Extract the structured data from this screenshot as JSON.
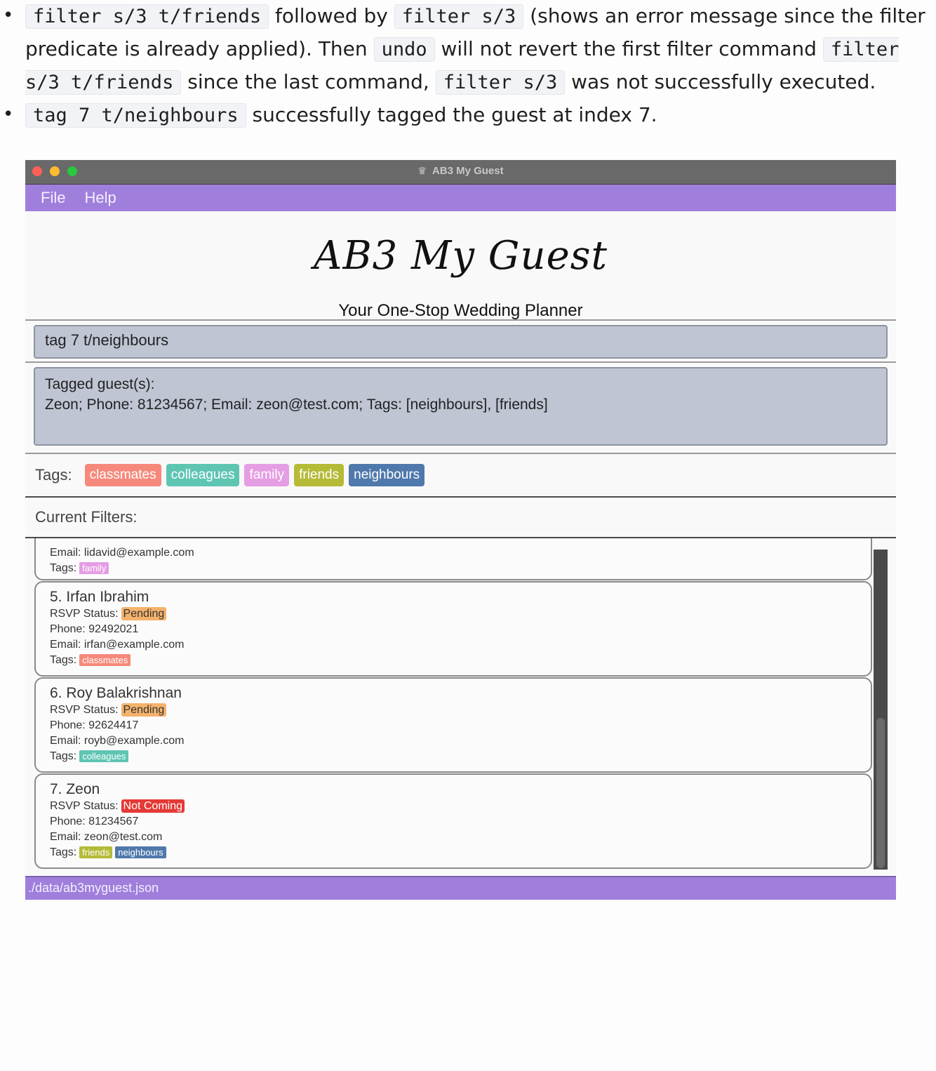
{
  "doc": {
    "bullet1": {
      "code1": "filter s/3 t/friends",
      "text1": " followed by ",
      "code2": "filter s/3",
      "text2": " (shows an error message since the filter predicate is already applied). Then ",
      "code3": "undo",
      "text3": " will not revert the first filter command ",
      "code4": "filter s/3 t/friends",
      "text4": " since the last command, ",
      "code5": "filter s/3",
      "text5": " was not successfully executed."
    },
    "bullet2": {
      "code1": "tag 7 t/neighbours",
      "text1": " successfully tagged the guest at index 7."
    }
  },
  "window": {
    "title": "AB3 My Guest",
    "menu": [
      "File",
      "Help"
    ],
    "logo": "AB3 My Guest",
    "tagline": "Your One-Stop Wedding Planner",
    "command_value": "tag 7 t/neighbours",
    "result_line1": "Tagged guest(s):",
    "result_line2": "Zeon; Phone: 81234567; Email: zeon@test.com; Tags: [neighbours], [friends]",
    "tags_label": "Tags:",
    "tags": [
      "classmates",
      "colleagues",
      "family",
      "friends",
      "neighbours"
    ],
    "filters_label": "Current Filters:",
    "status_path": "./data/ab3myguest.json"
  },
  "colors": {
    "classmates": "#f6897b",
    "colleagues": "#5fc5b3",
    "family": "#e59de3",
    "friends": "#b5bb37",
    "neighbours": "#4f78ab",
    "accent": "#a07fdc"
  },
  "guests": {
    "partial": {
      "email": "Email: lidavid@example.com",
      "tags_label": "Tags:",
      "tag": "family"
    },
    "g5": {
      "name": "5. Irfan Ibrahim",
      "rsvp_label": "RSVP Status:",
      "rsvp": "Pending",
      "phone": "Phone: 92492021",
      "email": "Email: irfan@example.com",
      "tags_label": "Tags:",
      "tag": "classmates"
    },
    "g6": {
      "name": "6. Roy Balakrishnan",
      "rsvp_label": "RSVP Status:",
      "rsvp": "Pending",
      "phone": "Phone: 92624417",
      "email": "Email: royb@example.com",
      "tags_label": "Tags:",
      "tag": "colleagues"
    },
    "g7": {
      "name": "7. Zeon",
      "rsvp_label": "RSVP Status:",
      "rsvp": "Not Coming",
      "phone": "Phone: 81234567",
      "email": "Email: zeon@test.com",
      "tags_label": "Tags:",
      "tag1": "friends",
      "tag2": "neighbours"
    }
  }
}
